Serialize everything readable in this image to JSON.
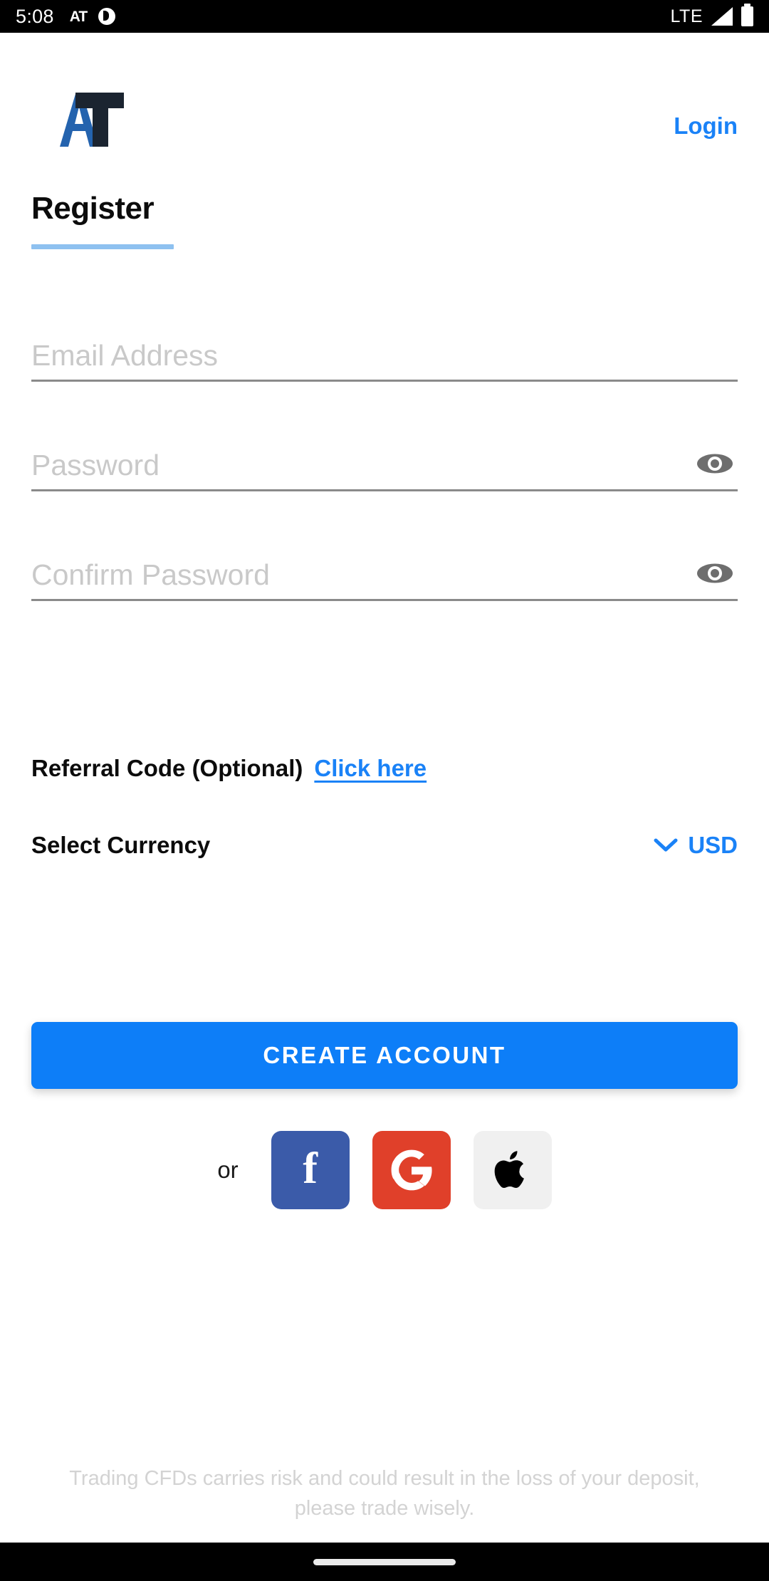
{
  "status_bar": {
    "time": "5:08",
    "app_icon_label": "AT",
    "network": "LTE",
    "icons": [
      "at-app-icon",
      "notification-circle-icon",
      "signal-icon",
      "battery-icon"
    ]
  },
  "header": {
    "logo_text": "AT",
    "logo_colors": {
      "a": "#2463ae",
      "t": "#1b2430"
    },
    "login_label": "Login"
  },
  "title": {
    "text": "Register",
    "underline_color": "#8ec1f0"
  },
  "form": {
    "email": {
      "placeholder": "Email Address",
      "value": ""
    },
    "password": {
      "placeholder": "Password",
      "value": "",
      "toggle_icon": "eye-icon"
    },
    "confirm_password": {
      "placeholder": "Confirm Password",
      "value": "",
      "toggle_icon": "eye-icon"
    }
  },
  "referral": {
    "label": "Referral Code (Optional)",
    "link_label": "Click here"
  },
  "currency": {
    "label": "Select Currency",
    "value": "USD",
    "chevron_icon": "chevron-down-icon",
    "accent_color": "#1a82f7"
  },
  "cta": {
    "label": "CREATE ACCOUNT",
    "color": "#0d7ef8"
  },
  "social": {
    "or_label": "or",
    "facebook": {
      "name": "Facebook",
      "glyph": "f",
      "color": "#3b5ba9"
    },
    "google": {
      "name": "Google",
      "glyph": "G",
      "color": "#e0402a"
    },
    "apple": {
      "name": "Apple",
      "glyph": "apple-logo",
      "color": "#f0f0f0"
    }
  },
  "footer": {
    "disclaimer": "Trading CFDs carries risk and could result in the loss of your deposit, please trade wisely."
  }
}
